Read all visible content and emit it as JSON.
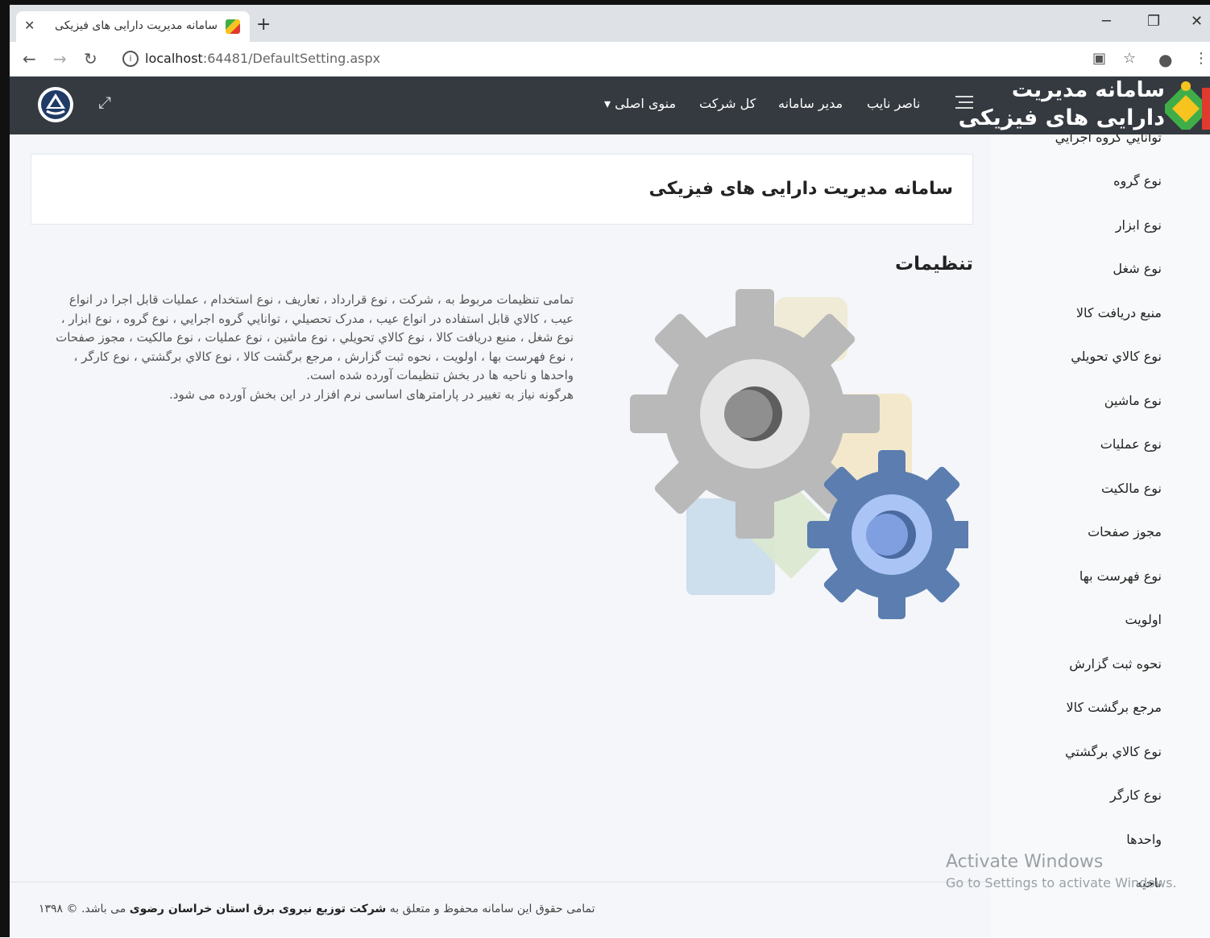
{
  "browser": {
    "tab_title": "سامانه مدیریت دارایی های فیزیکی",
    "url_host": "localhost",
    "url_path": ":64481/DefaultSetting.aspx"
  },
  "navbar": {
    "brand_line1": "سامانه مدیریت",
    "brand_line2": "دارایی های فیزیکی",
    "links": [
      "ناصر نایب",
      "مدیر سامانه",
      "کل شرکت",
      "منوی اصلی ▾"
    ]
  },
  "sidebar": {
    "items": [
      "توانایي گروه اجرایي",
      "نوع گروه",
      "نوع ابزار",
      "نوع شغل",
      "منبع دريافت کالا",
      "نوع کالاي تحويلي",
      "نوع ماشين",
      "نوع عمليات",
      "نوع مالکيت",
      "مجوز صفحات",
      "نوع فهرست بها",
      "اولويت",
      "نحوه ثبت گزارش",
      "مرجع برگشت کالا",
      "نوع کالاي برگشتي",
      "نوع کارگر",
      "واحدها",
      "ناحيه"
    ]
  },
  "main": {
    "card_title": "سامانه مدیریت دارایی های فیزیکی",
    "section_title": "تنظیمات",
    "description_line1": "تمامی تنظیمات مربوط به ، شرکت ، نوع قرارداد ، تعاریف ، نوع استخدام ، عملیات قابل اجرا در انواع عیب ، کالاي قابل استفاده در انواع عیب ، مدرک تحصیلي ، توانایي گروه اجرایي ، نوع گروه ، نوع ابزار ، نوع شغل ، منبع دریافت کالا ، نوع کالاي تحویلي ، نوع ماشین ، نوع عملیات ، نوع مالکیت ، مجوز صفحات ، نوع فهرست بها ، اولویت ، نحوه ثبت گزارش ، مرجع برگشت کالا ، نوع کالاي برگشتي ، نوع کارگر ، واحدها و ناحیه ها در بخش تنظیمات آورده شده است.",
    "description_line2": "هرگونه نیاز به تغییر در پارامترهای اساسی نرم افزار در این بخش آورده می شود."
  },
  "footer": {
    "prefix": "تمامی حقوق این سامانه محفوظ و متعلق به",
    "company": "شرکت توزیع نیروی برق استان خراسان رضوی",
    "suffix": "می باشد. © ۱۳۹۸"
  },
  "watermark": {
    "line1": "Activate Windows",
    "line2": "Go to Settings to activate Windows."
  },
  "colors": {
    "navbar_bg": "#343a40",
    "sidebar_bg": "#f8f9fa",
    "main_bg": "#f4f6f9",
    "gear_gray": "#b8b8b8",
    "gear_blue": "#5b7db0"
  },
  "icons": [
    "close-icon",
    "plus-icon",
    "back-icon",
    "forward-icon",
    "reload-icon",
    "info-icon",
    "translate-icon",
    "star-icon",
    "account-icon",
    "kebab-icon",
    "hamburger-icon",
    "expand-icon",
    "app-logo-icon",
    "gears-illustration"
  ]
}
